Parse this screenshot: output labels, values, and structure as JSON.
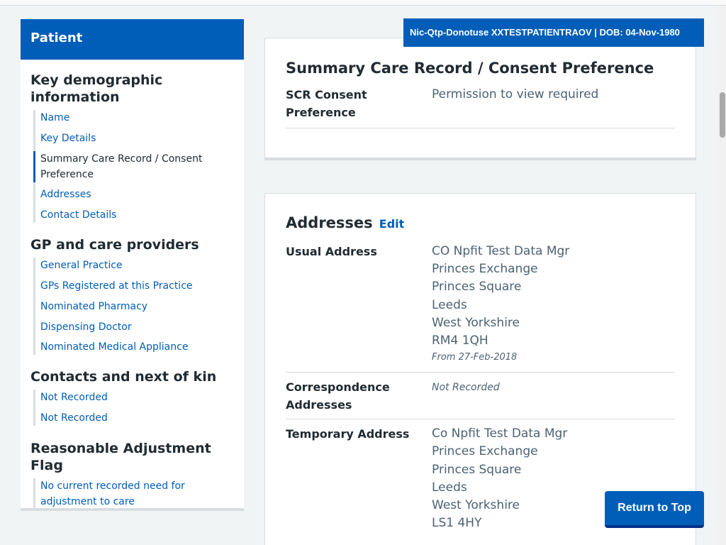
{
  "banner": {
    "text": "Nic-Qtp-Donotuse XXTESTPATIENTRAOV | DOB: 04-Nov-1980"
  },
  "sidebar": {
    "title": "Patient",
    "sections": [
      {
        "heading": "Key demographic information",
        "items": [
          "Name",
          "Key Details",
          "Summary Care Record / Consent Preference",
          "Addresses",
          "Contact Details"
        ]
      },
      {
        "heading": "GP and care providers",
        "items": [
          "General Practice",
          "GPs Registered at this Practice",
          "Nominated Pharmacy",
          "Dispensing Doctor",
          "Nominated Medical Appliance"
        ]
      },
      {
        "heading": "Contacts and next of kin",
        "items": [
          "Not Recorded",
          "Not Recorded"
        ]
      },
      {
        "heading": "Reasonable Adjustment Flag",
        "items": [
          "No current recorded need for adjustment to care"
        ]
      }
    ]
  },
  "scr_card": {
    "title": "Summary Care Record / Consent Preference",
    "label": "SCR Consent Preference",
    "value": "Permission to view required"
  },
  "addresses_card": {
    "title": "Addresses",
    "edit_label": "Edit",
    "usual": {
      "label": "Usual Address",
      "lines": [
        "CO Npfit Test Data Mgr",
        "Princes Exchange",
        "Princes Square",
        "Leeds",
        "West Yorkshire",
        "RM4 1QH"
      ],
      "from": "From 27-Feb-2018"
    },
    "correspondence": {
      "label": "Correspondence Addresses",
      "value": "Not Recorded"
    },
    "temporary": {
      "label": "Temporary Address",
      "lines": [
        "Co Npfit Test Data Mgr",
        "Princes Exchange",
        "Princes Square",
        "Leeds",
        "West Yorkshire",
        "LS1 4HY"
      ]
    }
  },
  "return_label": "Return to Top"
}
